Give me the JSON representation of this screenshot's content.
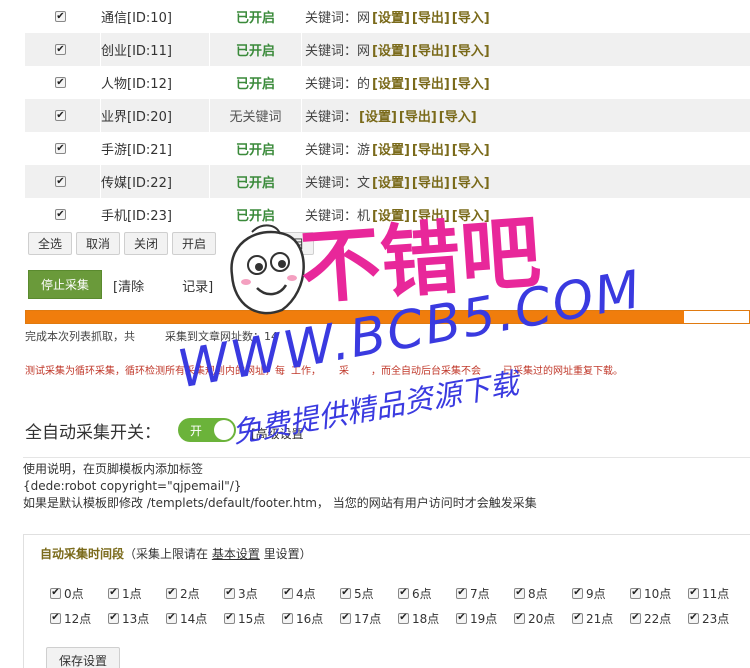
{
  "categories": [
    {
      "name": "通信[ID:10]",
      "status": "已开启",
      "keyword": "关键词：网"
    },
    {
      "name": "创业[ID:11]",
      "status": "已开启",
      "keyword": "关键词：网"
    },
    {
      "name": "人物[ID:12]",
      "status": "已开启",
      "keyword": "关键词：的"
    },
    {
      "name": "业界[ID:20]",
      "status": "无关键词",
      "keyword": "关键词："
    },
    {
      "name": "手游[ID:21]",
      "status": "已开启",
      "keyword": "关键词：游"
    },
    {
      "name": "传媒[ID:22]",
      "status": "已开启",
      "keyword": "关键词：文"
    },
    {
      "name": "手机[ID:23]",
      "status": "已开启",
      "keyword": "关键词：机"
    }
  ],
  "links": {
    "set": "[设置]",
    "export": "[导出]",
    "import": "[导入]"
  },
  "toolbar": {
    "select_all": "全选",
    "cancel": "取消",
    "close": "关闭",
    "open": "开启",
    "more": "个栏目"
  },
  "stop_button": "停止采集",
  "clear_link": "[清除",
  "clear_link_tail": "记录]",
  "progress": {
    "fraction": 0.91
  },
  "done_text": "完成本次列表抓取，共",
  "done_text_tail": "采集到文章网址数：14",
  "test_text": "测试采集为循环采集，循环检测所有采集规则内的网址，每",
  "test_text_tail": "工作，",
  "test_text_tail2": "采",
  "test_text_end": "，而全自动后台采集不会",
  "test_text_end2": "已采集过的网址重复下载。",
  "auto_switch": {
    "label": "全自动采集开关：",
    "state": "开",
    "advanced": "[高级设置"
  },
  "usage": {
    "line1": "使用说明，在页脚模板内添加标签",
    "line2": "{dede:robot copyright=\"qjpemail\"/}",
    "line3": "如果是默认模板即修改 /templets/default/footer.htm， 当您的网站有用户访问时才会触发采集"
  },
  "schedule": {
    "title": "自动采集时间段",
    "hint_prefix": "（采集上限请在 ",
    "hint_link": "基本设置",
    "hint_suffix": " 里设置）",
    "hours": [
      "0点",
      "1点",
      "2点",
      "3点",
      "4点",
      "5点",
      "6点",
      "7点",
      "8点",
      "9点",
      "10点",
      "11点",
      "12点",
      "13点",
      "14点",
      "15点",
      "16点",
      "17点",
      "18点",
      "19点",
      "20点",
      "21点",
      "22点",
      "23点"
    ],
    "save": "保存设置"
  },
  "watermark": {
    "title": "不错吧",
    "url": "WWW.BCB5.COM",
    "sub": "免费提供精品资源下载"
  },
  "colors": {
    "accent_green": "#6a9a3a",
    "progress_orange": "#f07d0c",
    "status_green": "#3a8a3a",
    "link_olive": "#7a6a1a",
    "warning_red": "#c0392b",
    "watermark_pink": "#e8279a",
    "watermark_blue": "#3a3ae0"
  }
}
